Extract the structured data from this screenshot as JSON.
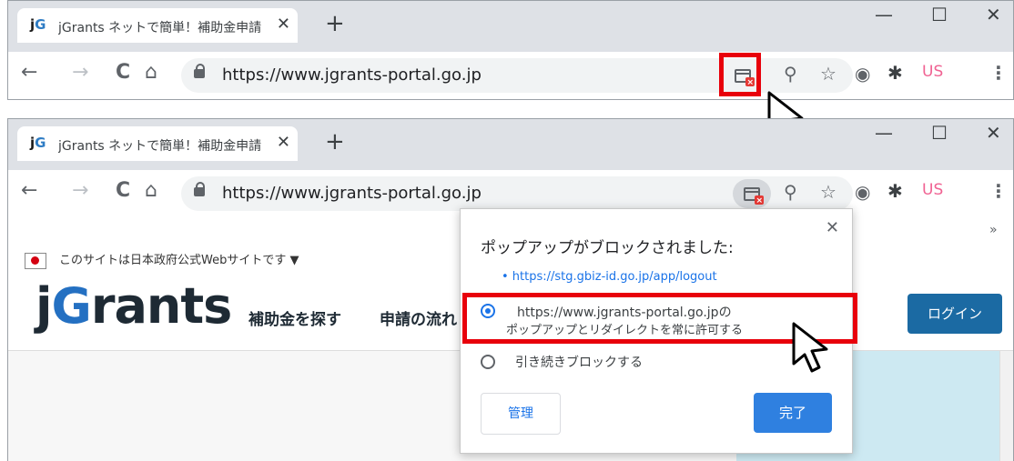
{
  "tab": {
    "favicon": "jG",
    "title": "jGrants ネットで簡単！補助金申請",
    "close": "✕",
    "new_tab": "+"
  },
  "window": {
    "minimize": "—",
    "maximize": "☐",
    "close": "✕"
  },
  "toolbar": {
    "back": "←",
    "forward": "→",
    "reload": "C",
    "home": "⌂",
    "url": "https://www.jgrants-portal.go.jp",
    "zoom_icon": "zoom-out-icon",
    "star": "☆",
    "profile": "US",
    "menu": "⋮",
    "overflow": "»"
  },
  "site": {
    "banner": "このサイトは日本政府公式Webサイトです ▼",
    "logo": {
      "part1": "j",
      "part2": "G",
      "part3": "rants"
    },
    "nav": [
      "補助金を探す",
      "申請の流れ"
    ],
    "login": "ログイン"
  },
  "popup": {
    "title": "ポップアップがブロックされました:",
    "blocked_link": "• https://stg.gbiz-id.go.jp/app/logout",
    "option_allow_line1": "https://www.jgrants-portal.go.jpの",
    "option_allow_line2": "ポップアップとリダイレクトを常に許可する",
    "option_block": "引き続きブロックする",
    "manage_button": "管理",
    "done_button": "完了",
    "close": "✕"
  },
  "colors": {
    "highlight": "#e8000b",
    "accent": "#1a73e8",
    "login": "#1b6aa3"
  }
}
